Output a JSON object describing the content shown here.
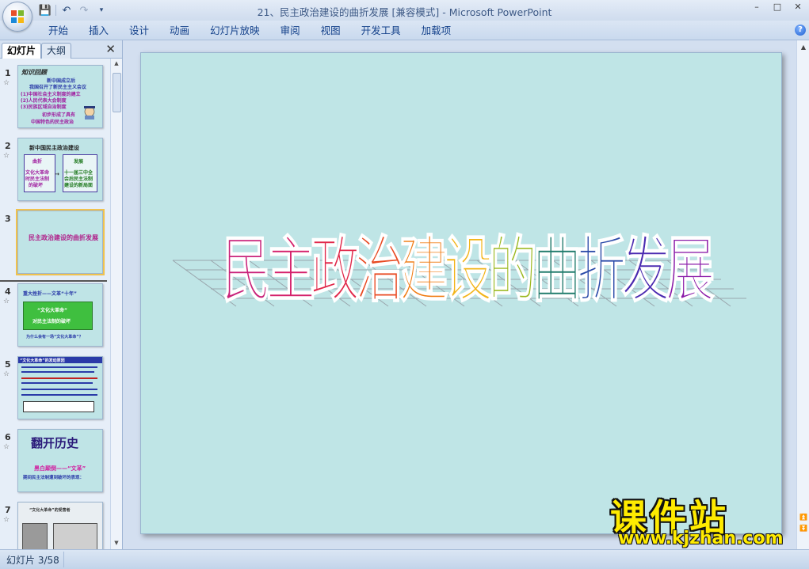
{
  "window": {
    "title": "21、民主政治建设的曲折发展 [兼容模式] - Microsoft PowerPoint",
    "min_glyph": "–",
    "max_glyph": "□",
    "close_glyph": "✕"
  },
  "qat": {
    "save": "💾",
    "undo": "↶",
    "redo": "↷",
    "more": "▾"
  },
  "ribbon": {
    "tabs": [
      "开始",
      "插入",
      "设计",
      "动画",
      "幻灯片放映",
      "审阅",
      "视图",
      "开发工具",
      "加载项"
    ],
    "help": "?"
  },
  "left_pane": {
    "tab_slides": "幻灯片",
    "tab_outline": "大纲",
    "close": "✕",
    "thumbnails": [
      {
        "num": "1",
        "anim": "☆",
        "lines": [
          "知识回顾",
          "新中国成立后",
          "我国召开了新民主主义会议",
          "(1)中国社会主义制度的建立",
          "(2)人民代表大会制度",
          "(3)民族区域自治制度",
          "初步形成了具有",
          "中国特色的民主政治"
        ]
      },
      {
        "num": "2",
        "anim": "☆",
        "lines": [
          "新中国民主政治建设",
          "曲折",
          "发展",
          "文化大革命",
          "时民主法制",
          "的破坏",
          "十一届三中全",
          "会后民主法制",
          "建设的新局面"
        ]
      },
      {
        "num": "3",
        "anim": "",
        "lines": [
          "民主政治建设的曲折发展"
        ]
      },
      {
        "num": "4",
        "anim": "☆",
        "lines": [
          "重大挫折——文革“十年”",
          "“文化大革命”",
          "对民主法制的破坏",
          "为什么会有一场“文化大革命”？"
        ]
      },
      {
        "num": "5",
        "anim": "☆",
        "lines": [
          "“文化大革命”的发动原因"
        ]
      },
      {
        "num": "6",
        "anim": "☆",
        "lines": [
          "翻开历史",
          "黑白颠倒——“文革”",
          "期间民主法制遭到破坏的表现："
        ]
      },
      {
        "num": "7",
        "anim": "☆",
        "lines": [
          "“文化大革命”的受害者"
        ]
      }
    ]
  },
  "slide": {
    "title_chars": [
      "民",
      "主",
      "政",
      "治",
      "建",
      "设",
      "的",
      "曲",
      "折",
      "发",
      "展"
    ],
    "colors": [
      "#c8227a",
      "#d4206a",
      "#e0284a",
      "#e84a22",
      "#f07b12",
      "#f2b418",
      "#9ab81e",
      "#1e7a6a",
      "#2a4aa8",
      "#4a2ab0",
      "#8a1aa8"
    ]
  },
  "watermark": {
    "main": "课件站",
    "url": "www.kjzhan.com"
  },
  "status": {
    "slide_info": "幻灯片 3/58"
  }
}
